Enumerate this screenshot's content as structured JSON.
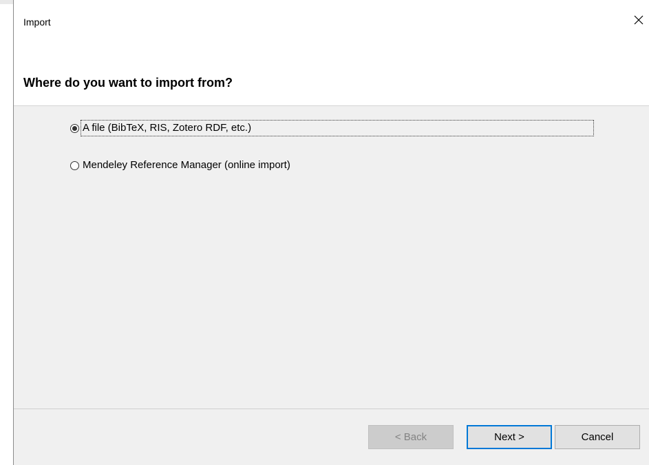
{
  "window": {
    "title": "Import"
  },
  "header": {
    "title": "Where do you want to import from?"
  },
  "options": [
    {
      "label": "A file (BibTeX, RIS, Zotero RDF, etc.)",
      "selected": true
    },
    {
      "label": "Mendeley Reference Manager (online import)",
      "selected": false
    }
  ],
  "buttons": {
    "back": "< Back",
    "next": "Next >",
    "cancel": "Cancel"
  },
  "icons": {
    "close": "close-icon"
  },
  "colors": {
    "content_bg": "#f0f0f0",
    "focus_border": "#0078d7"
  }
}
